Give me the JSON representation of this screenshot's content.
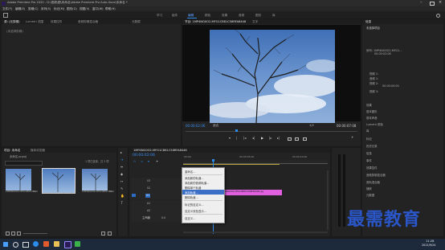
{
  "title_bar": {
    "title": "Adobe Premiere Pro 2020 - D:\\视频\\图\\未命名\\Adobe Premiere Pro Auto-Save\\未命名 *"
  },
  "menu": [
    "文件(F)",
    "编辑(E)",
    "剪辑(C)",
    "序列(S)",
    "标记(M)",
    "图形(G)",
    "视图(V)",
    "窗口(W)",
    "帮助(H)"
  ],
  "workspaces": [
    "学习",
    "组件",
    "编辑",
    "颜色",
    "效果",
    "音频",
    "图形",
    "库"
  ],
  "source_panel": {
    "tabs": [
      "源: (无剪辑)",
      "Lumetri 范围",
      "效果控件",
      "音频剪辑混合器",
      "元数据"
    ],
    "message": "(未选择剪辑)"
  },
  "program_monitor": {
    "tab": "节目: 1MP4NG0O2-MFG1CB81C58RFA8448",
    "tab2": "文字",
    "timecode_left": "00:00:02:06",
    "fit_label": "适合",
    "quality": "1/2",
    "timecode_right": "00:00:07:08"
  },
  "project_panel": {
    "tabs": [
      "项目: 未命名",
      "媒体浏览器"
    ],
    "path": "未命名.prproj",
    "item_count": "1 项已选择，共 3 项",
    "thumbs": [
      {
        "name": "1MP4NG0O2-MFG1CB81C58...",
        "dur": "5:00"
      },
      {
        "name": "1MP4NG0O2-MFG1CB81C58...",
        "dur": "5:00"
      },
      {
        "name": "1MP4NG0O2-MFG1CB81C58...",
        "dur": "5:00"
      }
    ]
  },
  "timeline": {
    "tab": "1MP4NG0O2-MFG1CB81C58RFA8448",
    "timecode": "00:00:02:06",
    "ruler": [
      "00:00",
      "00:00:05:00",
      "00:00:10:00"
    ],
    "tracks": [
      "V3",
      "V2",
      "V1",
      "A1",
      "A2",
      "A3"
    ],
    "master": "主声道",
    "master_value": "0.0",
    "clip_label": "1MP4NG0O2-MFG1CB81C58RFA8448.jpg"
  },
  "context_menu": {
    "items": [
      "重命名...",
      "添加新的轨道...",
      "添加新的音频轨道...",
      "删除单个轨道",
      "添加轨道...",
      "删除轨道...",
      "标记的自定义...",
      "自定义双色显示...",
      "自定义..."
    ],
    "highlighted_index": 4
  },
  "effects_panel": {
    "title": "信息",
    "selection": "未选择项目",
    "info_lines": [
      "序列: 1MP4NG0O2-MFG1...",
      "00:00:02:06",
      "视频 1:",
      "音频 1:",
      "视频 2:",
      "00:00:00:00",
      "视频 3:"
    ],
    "items": [
      "效果",
      "基本图形",
      "基本声音",
      "Lumetri 颜色",
      "库",
      "标记",
      "历史记录",
      "信息",
      "事件",
      "效果控件",
      "音频剪辑混合器",
      "音轨混合器",
      "捕获",
      "元数据"
    ]
  },
  "taskbar": {
    "time": "11:28",
    "date": "2021/9/24"
  },
  "watermark": "最需教育",
  "colors": {
    "accent": "#2d8ceb",
    "clip": "#e060e0",
    "timecode": "#3a8df0",
    "highlight": "#3b6fc7"
  }
}
